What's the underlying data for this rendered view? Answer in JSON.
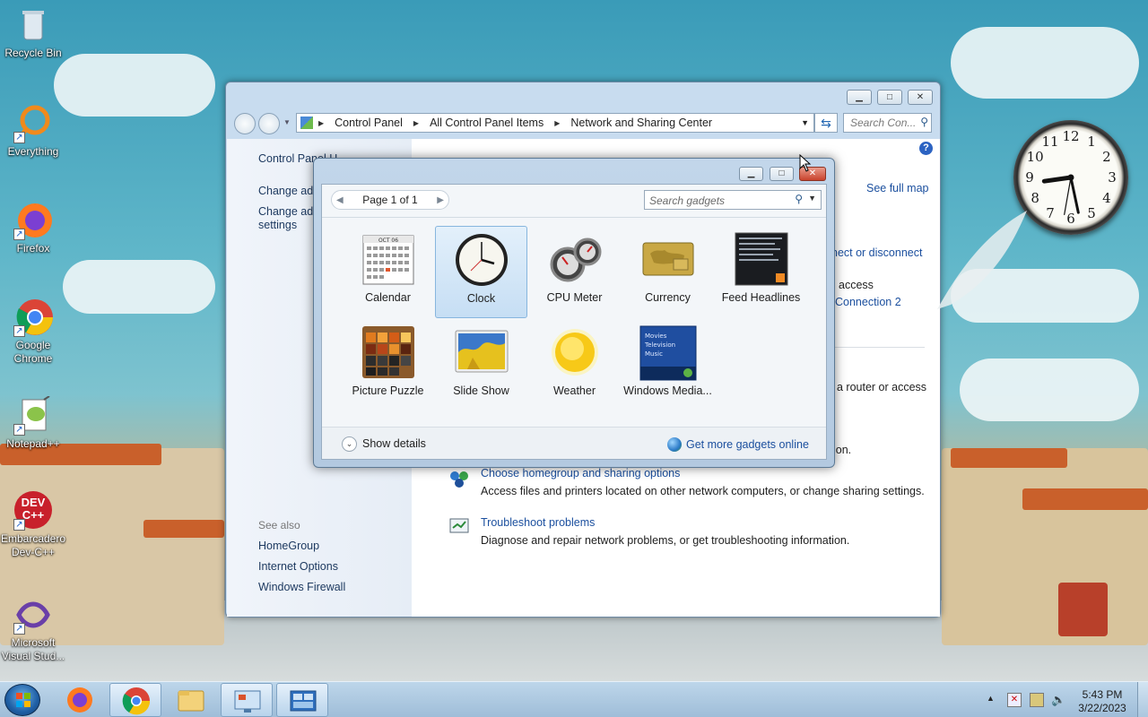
{
  "desktop": {
    "icons": [
      {
        "label": "Recycle Bin",
        "icon": "recycle-bin-icon"
      },
      {
        "label": "Everything",
        "icon": "everything-icon"
      },
      {
        "label": "Firefox",
        "icon": "firefox-icon"
      },
      {
        "label": "Google Chrome",
        "icon": "chrome-icon"
      },
      {
        "label": "Notepad++",
        "icon": "notepadpp-icon"
      },
      {
        "label": "Embarcadero Dev-C++",
        "icon": "devcpp-icon",
        "badge": "DEV\nC++"
      },
      {
        "label": "Microsoft Visual Stud...",
        "icon": "visual-studio-icon"
      }
    ]
  },
  "control_panel": {
    "breadcrumb": [
      "Control Panel",
      "All Control Panel Items",
      "Network and Sharing Center"
    ],
    "search_placeholder": "Search Con...",
    "left_nav": {
      "home": "Control Panel H...",
      "change_adapter": "Change ada...",
      "change_advanced_1": "Change adv...",
      "change_advanced_2": "settings",
      "see_also": "See also",
      "see_also_links": [
        "HomeGroup",
        "Internet Options",
        "Windows Firewall"
      ]
    },
    "main": {
      "see_full_map": "See full map",
      "connect_disconnect": "nect or disconnect",
      "access": "access",
      "connection": "Connection 2",
      "router": "a router or access",
      "ion": "ion.",
      "tasks": [
        {
          "title": "Choose homegroup and sharing options",
          "desc": "Access files and printers located on other network computers, or change sharing settings."
        },
        {
          "title": "Troubleshoot problems",
          "desc": "Diagnose and repair network problems, or get troubleshooting information."
        }
      ]
    }
  },
  "gadgets": {
    "pager": "Page 1 of 1",
    "search_placeholder": "Search gadgets",
    "items": [
      {
        "label": "Calendar",
        "selected": false
      },
      {
        "label": "Clock",
        "selected": true
      },
      {
        "label": "CPU Meter",
        "selected": false
      },
      {
        "label": "Currency",
        "selected": false
      },
      {
        "label": "Feed Headlines",
        "selected": false
      },
      {
        "label": "Picture Puzzle",
        "selected": false
      },
      {
        "label": "Slide Show",
        "selected": false
      },
      {
        "label": "Weather",
        "selected": false
      },
      {
        "label": "Windows Media...",
        "selected": false
      }
    ],
    "calendar_month": "OCT 06",
    "media_lines": [
      "Movies",
      "Television",
      "Music"
    ],
    "show_details": "Show details",
    "get_more": "Get more gadgets online"
  },
  "clock_gadget": {
    "numerals": [
      "12",
      "1",
      "2",
      "3",
      "4",
      "5",
      "6",
      "7",
      "8",
      "9",
      "10",
      "11"
    ]
  },
  "taskbar": {
    "time": "5:43 PM",
    "date": "3/22/2023"
  }
}
